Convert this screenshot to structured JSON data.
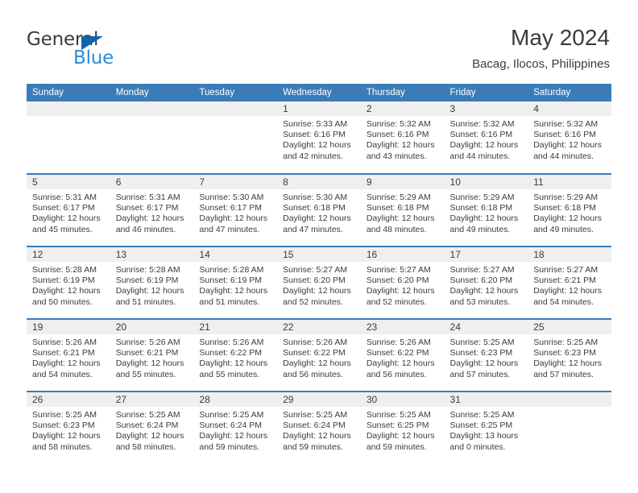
{
  "brand": {
    "name_top": "General",
    "name_bottom": "Blue",
    "triangle_color": "#1263ad",
    "blue_text_color": "#2e8bd6"
  },
  "header": {
    "title": "May 2024",
    "location": "Bacag, Ilocos, Philippines"
  },
  "theme": {
    "header_bar_color": "#3b7cb8",
    "daynum_band_color": "#efefef",
    "text_color": "#3b3b3b"
  },
  "calendar": {
    "weekday_headers": [
      "Sunday",
      "Monday",
      "Tuesday",
      "Wednesday",
      "Thursday",
      "Friday",
      "Saturday"
    ],
    "weeks": [
      [
        {
          "day": "",
          "lines": []
        },
        {
          "day": "",
          "lines": []
        },
        {
          "day": "",
          "lines": []
        },
        {
          "day": "1",
          "lines": [
            "Sunrise: 5:33 AM",
            "Sunset: 6:16 PM",
            "Daylight: 12 hours",
            "and 42 minutes."
          ]
        },
        {
          "day": "2",
          "lines": [
            "Sunrise: 5:32 AM",
            "Sunset: 6:16 PM",
            "Daylight: 12 hours",
            "and 43 minutes."
          ]
        },
        {
          "day": "3",
          "lines": [
            "Sunrise: 5:32 AM",
            "Sunset: 6:16 PM",
            "Daylight: 12 hours",
            "and 44 minutes."
          ]
        },
        {
          "day": "4",
          "lines": [
            "Sunrise: 5:32 AM",
            "Sunset: 6:16 PM",
            "Daylight: 12 hours",
            "and 44 minutes."
          ]
        }
      ],
      [
        {
          "day": "5",
          "lines": [
            "Sunrise: 5:31 AM",
            "Sunset: 6:17 PM",
            "Daylight: 12 hours",
            "and 45 minutes."
          ]
        },
        {
          "day": "6",
          "lines": [
            "Sunrise: 5:31 AM",
            "Sunset: 6:17 PM",
            "Daylight: 12 hours",
            "and 46 minutes."
          ]
        },
        {
          "day": "7",
          "lines": [
            "Sunrise: 5:30 AM",
            "Sunset: 6:17 PM",
            "Daylight: 12 hours",
            "and 47 minutes."
          ]
        },
        {
          "day": "8",
          "lines": [
            "Sunrise: 5:30 AM",
            "Sunset: 6:18 PM",
            "Daylight: 12 hours",
            "and 47 minutes."
          ]
        },
        {
          "day": "9",
          "lines": [
            "Sunrise: 5:29 AM",
            "Sunset: 6:18 PM",
            "Daylight: 12 hours",
            "and 48 minutes."
          ]
        },
        {
          "day": "10",
          "lines": [
            "Sunrise: 5:29 AM",
            "Sunset: 6:18 PM",
            "Daylight: 12 hours",
            "and 49 minutes."
          ]
        },
        {
          "day": "11",
          "lines": [
            "Sunrise: 5:29 AM",
            "Sunset: 6:18 PM",
            "Daylight: 12 hours",
            "and 49 minutes."
          ]
        }
      ],
      [
        {
          "day": "12",
          "lines": [
            "Sunrise: 5:28 AM",
            "Sunset: 6:19 PM",
            "Daylight: 12 hours",
            "and 50 minutes."
          ]
        },
        {
          "day": "13",
          "lines": [
            "Sunrise: 5:28 AM",
            "Sunset: 6:19 PM",
            "Daylight: 12 hours",
            "and 51 minutes."
          ]
        },
        {
          "day": "14",
          "lines": [
            "Sunrise: 5:28 AM",
            "Sunset: 6:19 PM",
            "Daylight: 12 hours",
            "and 51 minutes."
          ]
        },
        {
          "day": "15",
          "lines": [
            "Sunrise: 5:27 AM",
            "Sunset: 6:20 PM",
            "Daylight: 12 hours",
            "and 52 minutes."
          ]
        },
        {
          "day": "16",
          "lines": [
            "Sunrise: 5:27 AM",
            "Sunset: 6:20 PM",
            "Daylight: 12 hours",
            "and 52 minutes."
          ]
        },
        {
          "day": "17",
          "lines": [
            "Sunrise: 5:27 AM",
            "Sunset: 6:20 PM",
            "Daylight: 12 hours",
            "and 53 minutes."
          ]
        },
        {
          "day": "18",
          "lines": [
            "Sunrise: 5:27 AM",
            "Sunset: 6:21 PM",
            "Daylight: 12 hours",
            "and 54 minutes."
          ]
        }
      ],
      [
        {
          "day": "19",
          "lines": [
            "Sunrise: 5:26 AM",
            "Sunset: 6:21 PM",
            "Daylight: 12 hours",
            "and 54 minutes."
          ]
        },
        {
          "day": "20",
          "lines": [
            "Sunrise: 5:26 AM",
            "Sunset: 6:21 PM",
            "Daylight: 12 hours",
            "and 55 minutes."
          ]
        },
        {
          "day": "21",
          "lines": [
            "Sunrise: 5:26 AM",
            "Sunset: 6:22 PM",
            "Daylight: 12 hours",
            "and 55 minutes."
          ]
        },
        {
          "day": "22",
          "lines": [
            "Sunrise: 5:26 AM",
            "Sunset: 6:22 PM",
            "Daylight: 12 hours",
            "and 56 minutes."
          ]
        },
        {
          "day": "23",
          "lines": [
            "Sunrise: 5:26 AM",
            "Sunset: 6:22 PM",
            "Daylight: 12 hours",
            "and 56 minutes."
          ]
        },
        {
          "day": "24",
          "lines": [
            "Sunrise: 5:25 AM",
            "Sunset: 6:23 PM",
            "Daylight: 12 hours",
            "and 57 minutes."
          ]
        },
        {
          "day": "25",
          "lines": [
            "Sunrise: 5:25 AM",
            "Sunset: 6:23 PM",
            "Daylight: 12 hours",
            "and 57 minutes."
          ]
        }
      ],
      [
        {
          "day": "26",
          "lines": [
            "Sunrise: 5:25 AM",
            "Sunset: 6:23 PM",
            "Daylight: 12 hours",
            "and 58 minutes."
          ]
        },
        {
          "day": "27",
          "lines": [
            "Sunrise: 5:25 AM",
            "Sunset: 6:24 PM",
            "Daylight: 12 hours",
            "and 58 minutes."
          ]
        },
        {
          "day": "28",
          "lines": [
            "Sunrise: 5:25 AM",
            "Sunset: 6:24 PM",
            "Daylight: 12 hours",
            "and 59 minutes."
          ]
        },
        {
          "day": "29",
          "lines": [
            "Sunrise: 5:25 AM",
            "Sunset: 6:24 PM",
            "Daylight: 12 hours",
            "and 59 minutes."
          ]
        },
        {
          "day": "30",
          "lines": [
            "Sunrise: 5:25 AM",
            "Sunset: 6:25 PM",
            "Daylight: 12 hours",
            "and 59 minutes."
          ]
        },
        {
          "day": "31",
          "lines": [
            "Sunrise: 5:25 AM",
            "Sunset: 6:25 PM",
            "Daylight: 13 hours",
            "and 0 minutes."
          ]
        },
        {
          "day": "",
          "lines": []
        }
      ]
    ]
  }
}
